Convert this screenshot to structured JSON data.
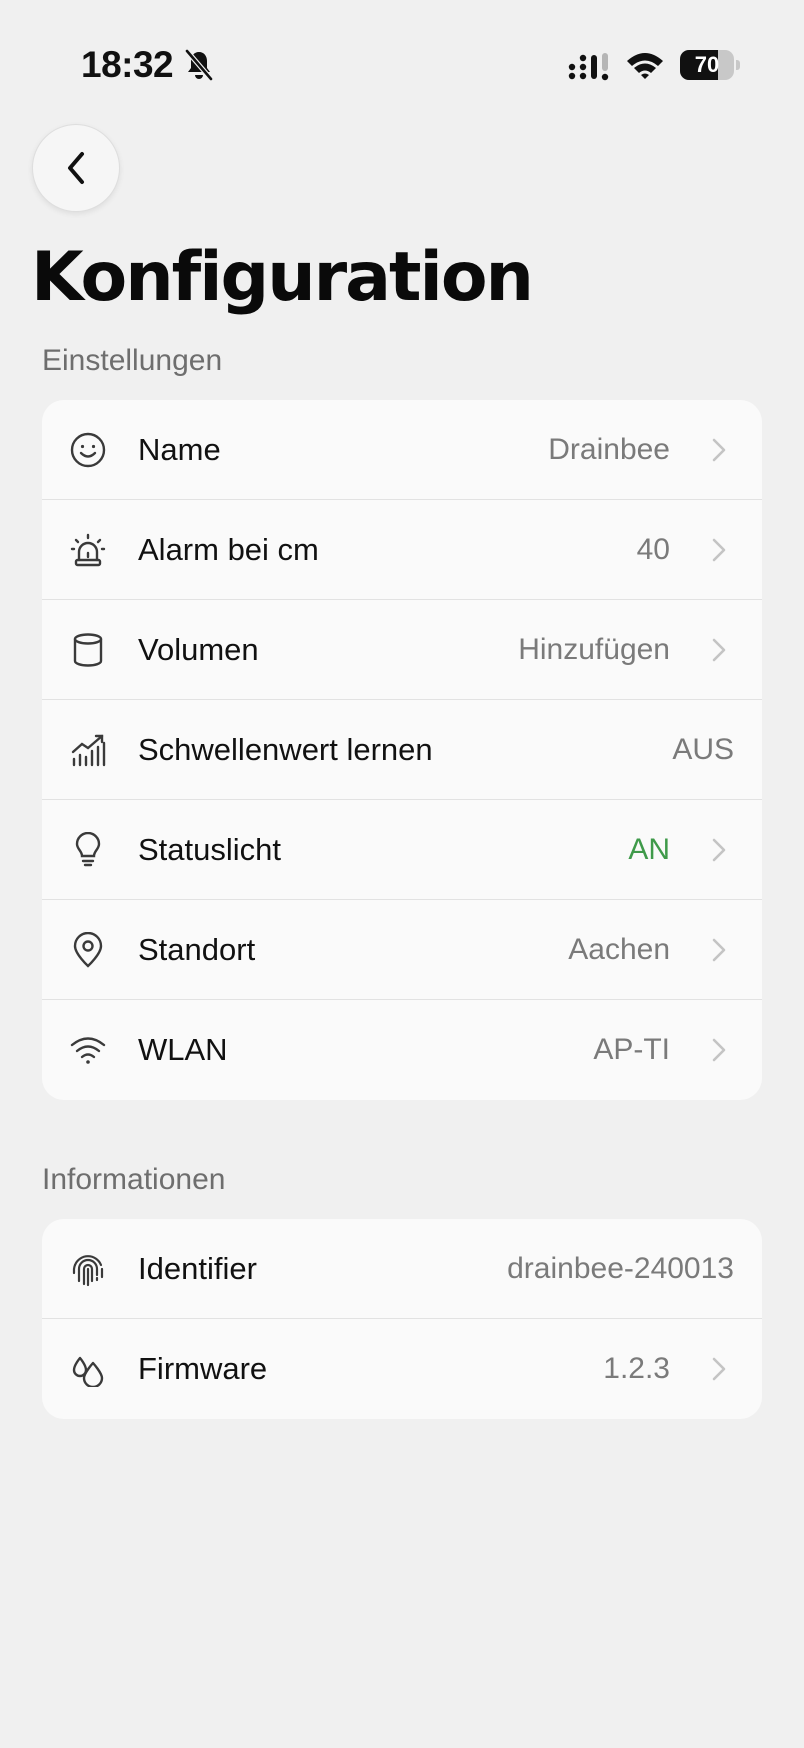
{
  "status_bar": {
    "time": "18:32",
    "battery_percent": "70",
    "battery_level": 0.7,
    "icons": [
      "bell-slash-icon",
      "cellular-signal-icon",
      "wifi-icon",
      "battery-icon"
    ]
  },
  "header": {
    "back_icon": "chevron-left-icon",
    "title": "Konfiguration"
  },
  "settings": {
    "section_label": "Einstellungen",
    "items": [
      {
        "icon": "smiley-icon",
        "label": "Name",
        "value": "Drainbee",
        "chevron": true
      },
      {
        "icon": "siren-icon",
        "label": "Alarm bei cm",
        "value": "40",
        "chevron": true
      },
      {
        "icon": "cylinder-icon",
        "label": "Volumen",
        "value": "Hinzufügen",
        "chevron": true
      },
      {
        "icon": "chart-growth-icon",
        "label": "Schwellenwert lernen",
        "value": "AUS",
        "chevron": false
      },
      {
        "icon": "lightbulb-icon",
        "label": "Statuslicht",
        "value": "AN",
        "chevron": true,
        "value_color": "#3f9a4a"
      },
      {
        "icon": "location-pin-icon",
        "label": "Standort",
        "value": "Aachen",
        "chevron": true
      },
      {
        "icon": "wifi-icon",
        "label": "WLAN",
        "value": "AP-TI",
        "chevron": true
      }
    ]
  },
  "information": {
    "section_label": "Informationen",
    "items": [
      {
        "icon": "fingerprint-icon",
        "label": "Identifier",
        "value": "drainbee-240013",
        "chevron": false
      },
      {
        "icon": "droplets-icon",
        "label": "Firmware",
        "value": "1.2.3",
        "chevron": true
      }
    ]
  },
  "colors": {
    "background": "#f0f0f0",
    "card": "#fafafa",
    "value_gray": "#7a7a7a",
    "accent_green": "#3f9a4a"
  }
}
